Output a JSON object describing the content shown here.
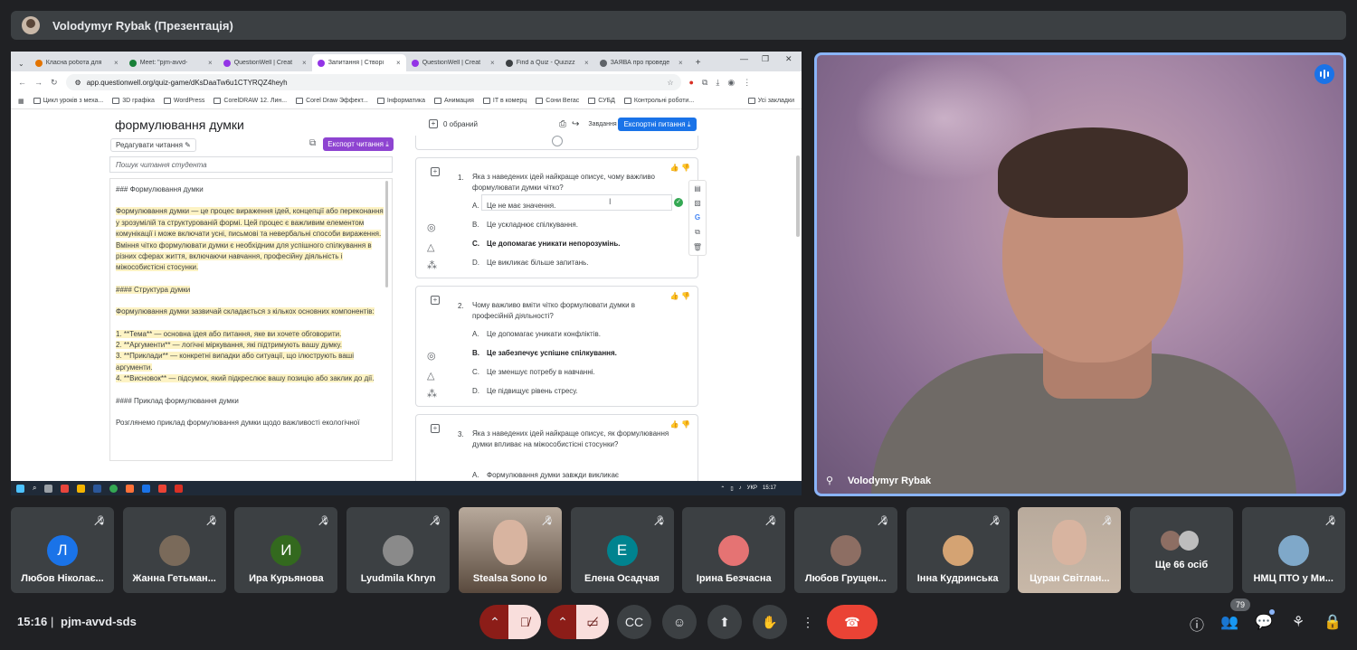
{
  "presentation_title": "Volodymyr Rybak (Презентація)",
  "browser": {
    "tabs": [
      {
        "label": "Класна робота для",
        "color": "#e37400",
        "active": false
      },
      {
        "label": "Meet: \"pjm-avvd-",
        "color": "#188038",
        "active": false
      },
      {
        "label": "QuestionWell | Creat",
        "color": "#9334e6",
        "active": false
      },
      {
        "label": "Запитання | Створі",
        "color": "#9334e6",
        "active": true
      },
      {
        "label": "QuestionWell | Creat",
        "color": "#9334e6",
        "active": false
      },
      {
        "label": "Find a Quiz - Quizizz",
        "color": "#3c4043",
        "active": false
      },
      {
        "label": "ЗАЯВА про проведе",
        "color": "#5f6368",
        "active": false
      }
    ],
    "url": "app.questionwell.org/quiz-game/dKsDaaTw6u1CTYRQZ4heyh",
    "bookmarks": [
      "Цикл уроків з меха...",
      "3D графіка",
      "WordPress",
      "CorelDRAW 12. Лин...",
      "Corel Draw Эффект...",
      "Інформатика",
      "Анимация",
      "IT в комерц",
      "Сони Вегас",
      "СУБД",
      "Контрольні роботи...",
      "Усі закладки"
    ]
  },
  "reading": {
    "title": "формулювання думки",
    "edit_label": "Редагувати читання",
    "export_label": "Експорт читання",
    "search_placeholder": "Пошук читання студента",
    "paragraphs": [
      {
        "text": "### Формулювання думки",
        "hl": false
      },
      {
        "text": "Формулювання думки — це процес вираження ідей, концепції або переконання у зрозумілій та структурованій формі. Цей процес є важливим елементом комунікації і може включати усні, письмові та невербальні способи вираження. Вміння чітко формулювати думки є необхідним для успішного спілкування в різних сферах життя, включаючи навчання, професійну діяльність і міжособистісні стосунки.",
        "hl": true
      },
      {
        "text": "#### Структура думки",
        "hl": true
      },
      {
        "text": "Формулювання думки зазвичай складається з кількох основних компонентів:",
        "hl": true
      },
      {
        "text": "1. **Тема** — основна ідея або питання, яке ви хочете обговорити.\n2. **Аргументи** — логічні міркування, які підтримують вашу думку.\n3. **Приклади** — конкретні випадки або ситуації, що ілюструють ваші аргументи.\n4. **Висновок** — підсумок, який підкреслює вашу позицію або заклик до дії.",
        "hl": true
      },
      {
        "text": "#### Приклад формулювання думки",
        "hl": false
      },
      {
        "text": "Розглянемо приклад формулювання думки щодо важливості екологічної",
        "hl": false
      }
    ]
  },
  "questions_toolbar": {
    "selected": "0 обраний",
    "tasks": "Завдання",
    "export_label": "Експортні питання"
  },
  "questions": [
    {
      "num": "1.",
      "text": "Яка з наведених ідей найкраще описує, чому важливо формулювати думки чітко?",
      "options": [
        {
          "letter": "A.",
          "text": "Це не має значення.",
          "correct": false
        },
        {
          "letter": "B.",
          "text": "Це ускладнює спілкування.",
          "correct": false
        },
        {
          "letter": "C.",
          "text": "Це допомагає уникати непорозумінь.",
          "correct": true
        },
        {
          "letter": "D.",
          "text": "Це викликає більше запитань.",
          "correct": false
        }
      ]
    },
    {
      "num": "2.",
      "text": "Чому важливо вміти чітко формулювати думки в професійній діяльності?",
      "options": [
        {
          "letter": "A.",
          "text": "Це допомагає уникати конфліктів.",
          "correct": false
        },
        {
          "letter": "B.",
          "text": "Це забезпечує успішне спілкування.",
          "correct": true
        },
        {
          "letter": "C.",
          "text": "Це зменшує потребу в навчанні.",
          "correct": false
        },
        {
          "letter": "D.",
          "text": "Це підвищує рівень стресу.",
          "correct": false
        }
      ]
    },
    {
      "num": "3.",
      "text": "Яка з наведених ідей найкраще описує, як формулювання думки впливає на міжособистісні стосунки?",
      "options": [
        {
          "letter": "A.",
          "text": "Формулювання думки завжди викликає",
          "correct": false
        }
      ]
    }
  ],
  "taskbar": {
    "lang": "УКР",
    "time": "15:17"
  },
  "camera": {
    "name": "Volodymyr Rybak"
  },
  "participants": [
    {
      "name": "Любов Ніколає...",
      "initial": "Л",
      "color": "#1a73e8",
      "type": "letter"
    },
    {
      "name": "Жанна Гетьман...",
      "initial": "",
      "color": "#7a6a5a",
      "type": "photo"
    },
    {
      "name": "Ира Курьянова",
      "initial": "И",
      "color": "#33691e",
      "type": "letter"
    },
    {
      "name": "Lyudmila Khryn",
      "initial": "",
      "color": "#8a8a8a",
      "type": "photo"
    },
    {
      "name": "Stealsa Sono Io",
      "initial": "",
      "color": "#5a4a3e",
      "type": "video"
    },
    {
      "name": "Елена Осадчая",
      "initial": "Е",
      "color": "#00838f",
      "type": "letter"
    },
    {
      "name": "Ірина Безчасна",
      "initial": "",
      "color": "#e57373",
      "type": "photo"
    },
    {
      "name": "Любов Грущен...",
      "initial": "",
      "color": "#8d6e63",
      "type": "photo"
    },
    {
      "name": "Інна Кудринська",
      "initial": "",
      "color": "#d4a373",
      "type": "photo"
    },
    {
      "name": "Цуран Світлан...",
      "initial": "",
      "color": "#c8b8a8",
      "type": "video"
    },
    {
      "name": "Ще 66 осіб",
      "initial": "",
      "color": "#5f6368",
      "type": "more"
    },
    {
      "name": "НМЦ ПТО у Ми...",
      "initial": "",
      "color": "#7fa8c9",
      "type": "photo"
    }
  ],
  "footer": {
    "time": "15:16",
    "separator": "|",
    "meeting_code": "pjm-avvd-sds",
    "people_count": "79"
  },
  "colors": {
    "accent": "#8ab4f8",
    "hangup": "#ea4335",
    "export_purple": "#8e44d1",
    "export_blue": "#1a73e8"
  }
}
